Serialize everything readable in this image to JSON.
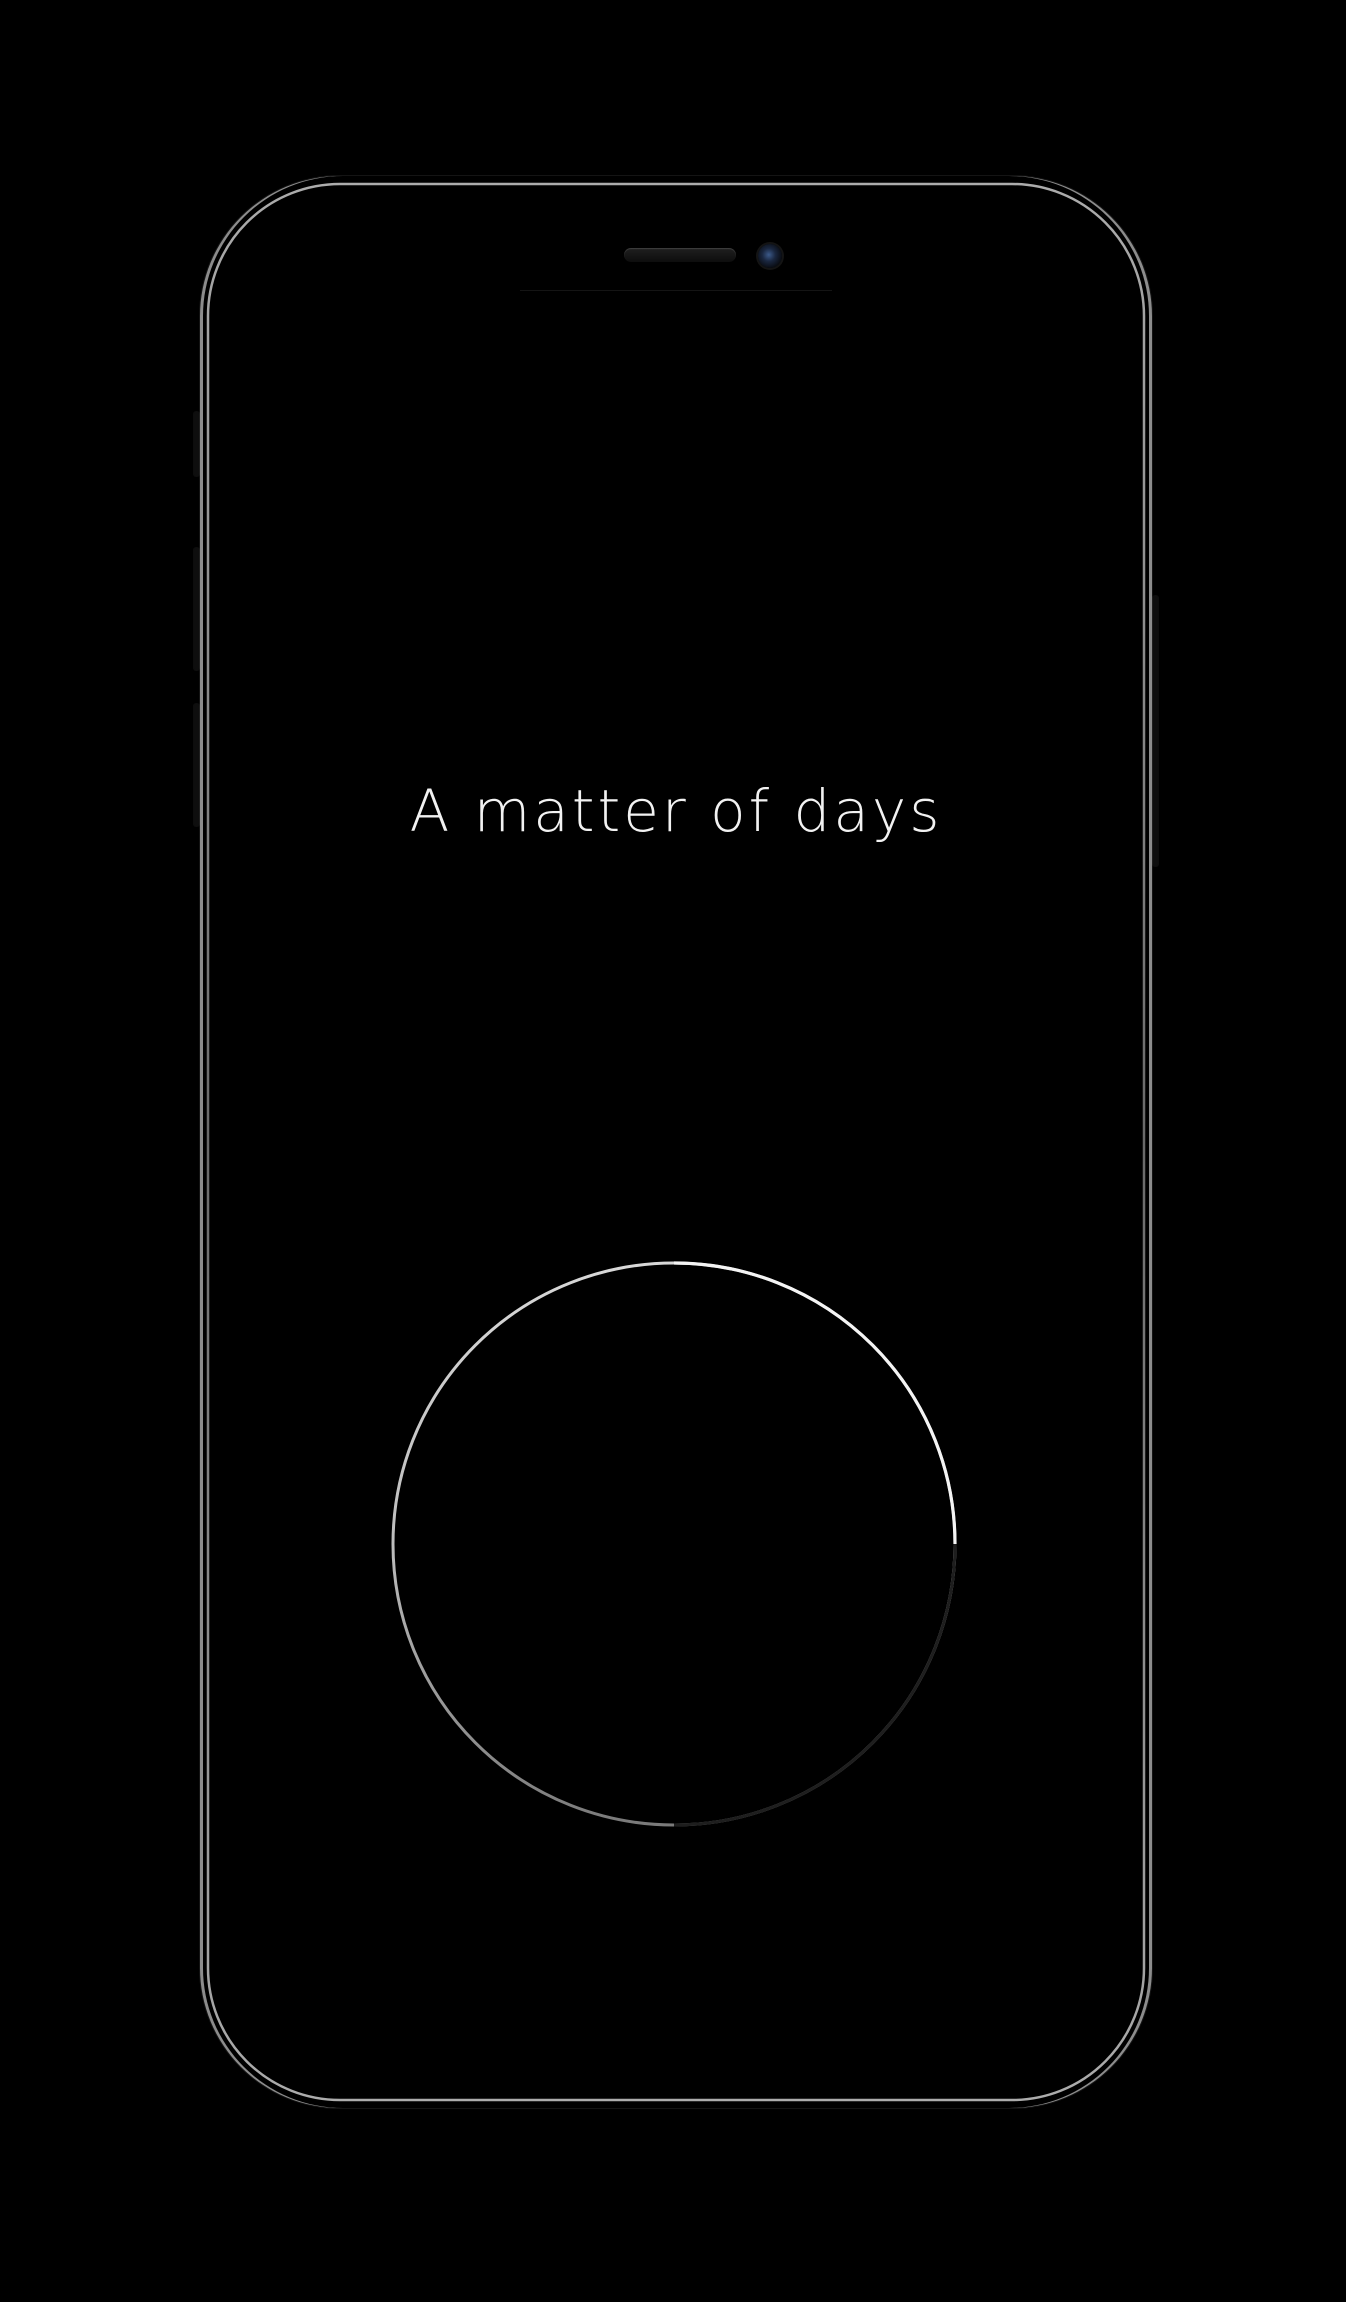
{
  "screen": {
    "title": "A matter of days",
    "progress_ring": {
      "shape": "circle",
      "stroke_color": "#dcdcdc",
      "fade_color": "#000000"
    }
  },
  "device": {
    "frame_color": "#000000",
    "bezel_highlight": "#ffffff"
  }
}
